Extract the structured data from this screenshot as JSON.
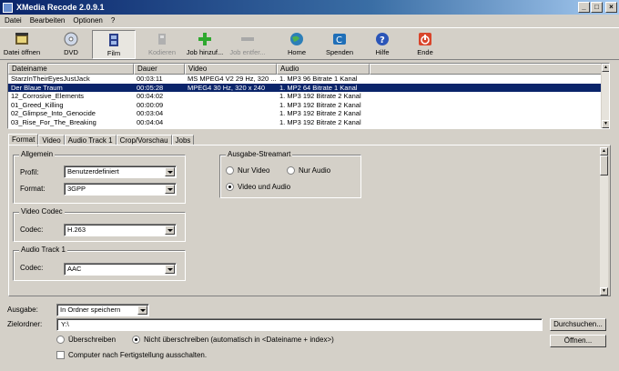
{
  "window": {
    "title": "XMedia Recode 2.0.9.1",
    "controls": [
      "_",
      "□",
      "×"
    ]
  },
  "menu": [
    "Datei",
    "Bearbeiten",
    "Optionen",
    "?"
  ],
  "toolbar": {
    "open_label": "Datei öffnen",
    "dvd_label": "DVD",
    "film_label": "Film",
    "encode_label": "Kodieren",
    "add_job_label": "Job hinzuf...",
    "remove_job_label": "Job entfer...",
    "home_label": "Home",
    "donate_label": "Spenden",
    "help_label": "Hilfe",
    "exit_label": "Ende"
  },
  "filelist": {
    "columns": [
      "Dateiname",
      "Dauer",
      "Video",
      "Audio"
    ],
    "rows": [
      {
        "name": "StarzInTheirEyesJustJack",
        "duration": "00:03:11",
        "video": "MS MPEG4 V2 29 Hz, 320 ...",
        "audio": "1. MP3 96 Bitrate 1 Kanal"
      },
      {
        "name": "Der Blaue Traum",
        "duration": "00:05:28",
        "video": "MPEG4 30 Hz, 320 x 240",
        "audio": "1. MP2 64 Bitrate 1 Kanal"
      },
      {
        "name": "12_Corrosive_Elements",
        "duration": "00:04:02",
        "video": "",
        "audio": "1. MP3 192 Bitrate 2 Kanal"
      },
      {
        "name": "01_Greed_Killing",
        "duration": "00:00:09",
        "video": "",
        "audio": "1. MP3 192 Bitrate 2 Kanal"
      },
      {
        "name": "02_Glimpse_Into_Genocide",
        "duration": "00:03:04",
        "video": "",
        "audio": "1. MP3 192 Bitrate 2 Kanal"
      },
      {
        "name": "03_Rise_For_The_Breaking",
        "duration": "00:04:04",
        "video": "",
        "audio": "1. MP3 192 Bitrate 2 Kanal"
      }
    ]
  },
  "tabs": [
    "Format",
    "Video",
    "Audio Track 1",
    "Crop/Vorschau",
    "Jobs"
  ],
  "format_tab": {
    "allgemein": {
      "title": "Allgemein",
      "profile_label": "Profil:",
      "profile_value": "Benutzerdefiniert",
      "format_label": "Format:",
      "format_value": "3GPP"
    },
    "video_codec": {
      "title": "Video Codec",
      "codec_label": "Codec:",
      "codec_value": "H.263"
    },
    "audio_track": {
      "title": "Audio Track 1",
      "codec_label": "Codec:",
      "codec_value": "AAC"
    },
    "stream": {
      "title": "Ausgabe-Streamart",
      "only_video": "Nur Video",
      "only_audio": "Nur Audio",
      "video_audio": "Video und Audio"
    }
  },
  "output": {
    "label": "Ausgabe:",
    "value": "In Ordner speichern",
    "folder_label": "Zielordner:",
    "folder_value": "Y:\\",
    "browse": "Durchsuchen...",
    "open": "Öffnen...",
    "overwrite": "Überschreiben",
    "no_overwrite": "Nicht überschreiben (automatisch in <Dateiname + index>)",
    "shutdown": "Computer nach Fertigstellung ausschalten."
  }
}
